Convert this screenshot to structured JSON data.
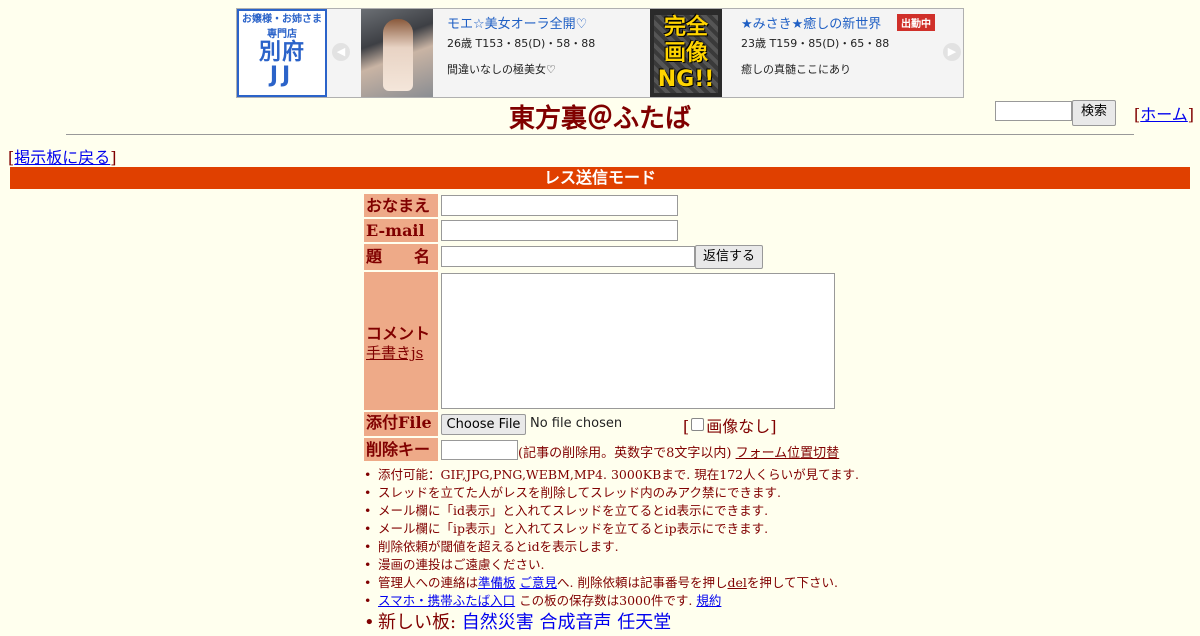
{
  "banner": {
    "shop_logo": {
      "line1": "お嬢様・お姉さま",
      "line2": "専門店",
      "line3": "別府",
      "line4": "JJ"
    },
    "ads": [
      {
        "title": "モエ☆美女オーラ全開♡",
        "stats": "26歳 T153・85(D)・58・88",
        "desc": "間違いなしの極美女♡"
      },
      {
        "title": "★みさき★癒しの新世界",
        "stats": "23歳 T159・85(D)・65・88",
        "desc": "癒しの真髄ここにあり",
        "badge": "出勤中"
      }
    ],
    "photo2_text": "完全画像NG!!"
  },
  "header": {
    "title": "東方裏＠ふたば",
    "search_button": "検索",
    "home_link": "ホーム",
    "back_link": "掲示板に戻る"
  },
  "mode_bar": "レス送信モード",
  "form": {
    "name_label": "おなまえ",
    "email_label": "E-mail",
    "subject_label": "題　　名",
    "reply_button": "返信する",
    "comment_label": "コメント",
    "handwriting_link": "手書きjs",
    "file_label": "添付File",
    "choose_file": "Choose File",
    "no_file": "No file chosen",
    "no_image": "画像なし",
    "delkey_label": "削除キー",
    "delkey_note": "(記事の削除用。英数字で8文字以内)",
    "form_toggle": "フォーム位置切替"
  },
  "notes": [
    "添付可能：GIF,JPG,PNG,WEBM,MP4. 3000KBまで. 現在172人くらいが見てます.",
    "スレッドを立てた人がレスを削除してスレッド内のみアク禁にできます.",
    "メール欄に「id表示」と入れてスレッドを立てるとid表示にできます.",
    "メール欄に「ip表示」と入れてスレッドを立てるとip表示にできます.",
    "削除依頼が閾値を超えるとidを表示します.",
    "漫画の連投はご遠慮ください."
  ],
  "admin_note": {
    "prefix": "管理人への連絡は",
    "link1": "準備板",
    "link2": "ご意見",
    "middle": "へ. 削除依頼は記事番号を押し",
    "link3": "del",
    "suffix": "を押して下さい."
  },
  "mobile_note": {
    "link": "スマホ・携帯ふたば入口",
    "text": " この板の保存数は3000件です. ",
    "rules_link": "規約"
  },
  "new_boards": {
    "label": "新しい板: ",
    "boards": [
      "自然災害",
      "合成音声",
      "任天堂"
    ]
  }
}
